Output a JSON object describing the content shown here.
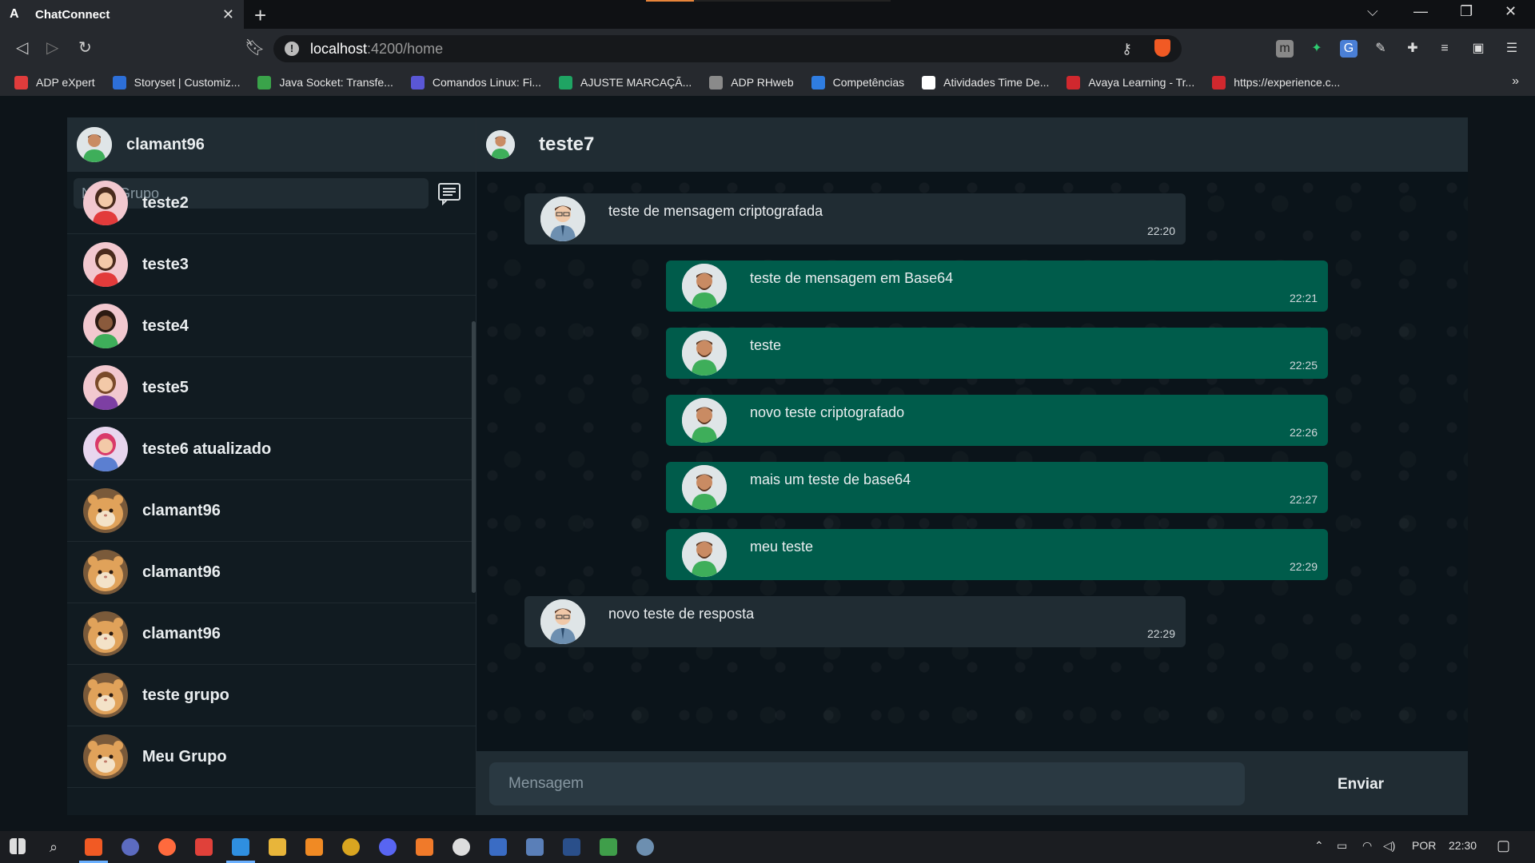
{
  "browser": {
    "tab_title": "ChatConnect",
    "tab_favicon": "A",
    "url_host": "localhost",
    "url_path": ":4200/home",
    "bookmarks": [
      {
        "label": "ADP eXpert",
        "color": "#e03c3c"
      },
      {
        "label": "Storyset | Customiz...",
        "color": "#2d6fd8"
      },
      {
        "label": "Java Socket: Transfe...",
        "color": "#3aa34a"
      },
      {
        "label": "Comandos Linux: Fi...",
        "color": "#5a57d6"
      },
      {
        "label": "AJUSTE MARCAÇÃ...",
        "color": "#1fa463"
      },
      {
        "label": "ADP RHweb",
        "color": "#8a8a8a"
      },
      {
        "label": "Competências",
        "color": "#2f7de1"
      },
      {
        "label": "Atividades Time De...",
        "color": "#ffffff"
      },
      {
        "label": "Avaya Learning - Tr...",
        "color": "#d0282e"
      },
      {
        "label": "https://experience.c...",
        "color": "#d0282e"
      }
    ]
  },
  "sidebar": {
    "current_user": "clamant96",
    "new_group_placeholder": "Novo Grupo",
    "contacts": [
      {
        "name": "teste2",
        "avatar": "girl-red"
      },
      {
        "name": "teste3",
        "avatar": "girl-red"
      },
      {
        "name": "teste4",
        "avatar": "girl-curly"
      },
      {
        "name": "teste5",
        "avatar": "girl-purple"
      },
      {
        "name": "teste6 atualizado",
        "avatar": "girl-cap"
      },
      {
        "name": "clamant96",
        "avatar": "hamster"
      },
      {
        "name": "clamant96",
        "avatar": "hamster"
      },
      {
        "name": "clamant96",
        "avatar": "hamster"
      },
      {
        "name": "teste grupo",
        "avatar": "hamster"
      },
      {
        "name": "Meu Grupo",
        "avatar": "hamster"
      }
    ]
  },
  "chat": {
    "title": "teste7",
    "messages": [
      {
        "text": "teste de mensagem criptografada",
        "time": "22:20",
        "direction": "in"
      },
      {
        "text": "teste de mensagem em Base64",
        "time": "22:21",
        "direction": "out"
      },
      {
        "text": "teste",
        "time": "22:25",
        "direction": "out"
      },
      {
        "text": "novo teste criptografado",
        "time": "22:26",
        "direction": "out"
      },
      {
        "text": "mais um teste de base64",
        "time": "22:27",
        "direction": "out"
      },
      {
        "text": "meu teste",
        "time": "22:29",
        "direction": "out"
      },
      {
        "text": "novo teste de resposta",
        "time": "22:29",
        "direction": "in"
      }
    ],
    "input_placeholder": "Mensagem",
    "send_label": "Enviar"
  },
  "taskbar": {
    "language": "POR",
    "clock": "22:30"
  },
  "colors": {
    "outgoing_bubble": "#005c4b",
    "incoming_bubble": "#202c33",
    "panel_header": "#202c33"
  }
}
